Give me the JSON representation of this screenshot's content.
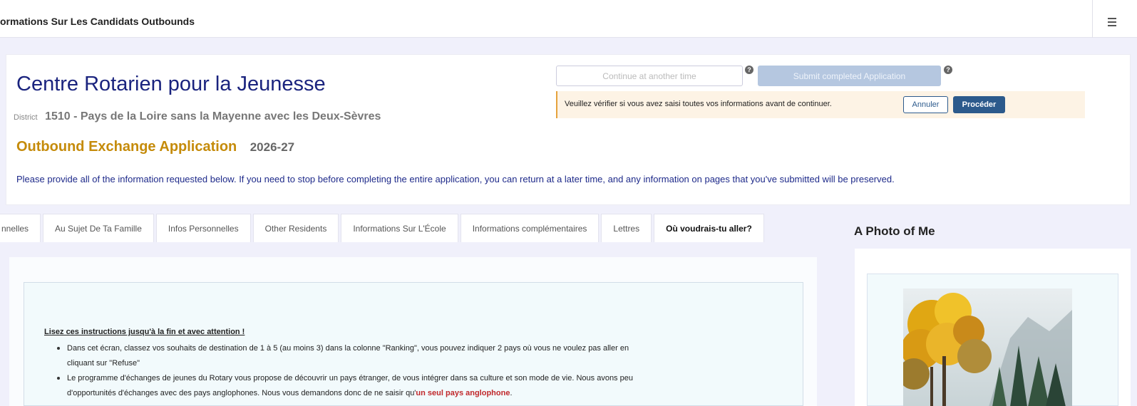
{
  "topbar": {
    "title": "ormations Sur Les Candidats Outbounds"
  },
  "header": {
    "org_title": "Centre Rotarien pour la Jeunesse",
    "district_label": "District",
    "district_value": "1510 - Pays de la Loire sans la Mayenne avec les Deux-Sèvres",
    "app_title": "Outbound Exchange Application",
    "app_year": "2026-27",
    "instructions": "Please provide all of the information requested below. If you need to stop before completing the entire application, you can return at a later time, and any information on pages that you've submitted will be preserved."
  },
  "actions": {
    "continue_label": "Continue at another time",
    "submit_label": "Submit completed Application",
    "help_glyph": "?",
    "confirm_text": "Veuillez vérifier si vous avez saisi toutes vos informations avant de continuer.",
    "cancel_label": "Annuler",
    "proceed_label": "Procéder"
  },
  "tabs": [
    {
      "label": "nnelles",
      "active": false
    },
    {
      "label": "Au Sujet De Ta Famille",
      "active": false
    },
    {
      "label": "Infos Personnelles",
      "active": false
    },
    {
      "label": "Other Residents",
      "active": false
    },
    {
      "label": "Informations Sur L'École",
      "active": false
    },
    {
      "label": "Informations complémentaires",
      "active": false
    },
    {
      "label": "Lettres",
      "active": false
    },
    {
      "label": "Où voudrais-tu aller?",
      "active": true
    }
  ],
  "photo": {
    "title": "A Photo of Me"
  },
  "content": {
    "read_title": "Lisez ces instructions jusqu'à la fin et avec attention !",
    "bullet1_line1": "Dans cet écran, classez vos souhaits de destination de 1 à 5 (au moins 3) dans la colonne \"Ranking\", vous pouvez indiquer 2 pays où vous ne voulez pas aller en",
    "bullet1_line2": "cliquant sur \"Refuse\"",
    "bullet2_line1": "Le programme d'échanges de jeunes du Rotary vous propose de découvrir un pays étranger, de vous intégrer dans sa culture et son mode de vie. Nous avons peu",
    "bullet2_line2_a": "d'opportunités d'échanges avec des pays anglophones. Nous vous demandons donc de ne saisir qu'",
    "bullet2_line2_b": "un seul pays anglophone",
    "bullet2_line2_c": "."
  },
  "colors": {
    "title_navy": "#1a237e",
    "app_gold": "#c58b0a",
    "button_blue": "#2c5a8c",
    "highlight_red": "#c0282b"
  }
}
